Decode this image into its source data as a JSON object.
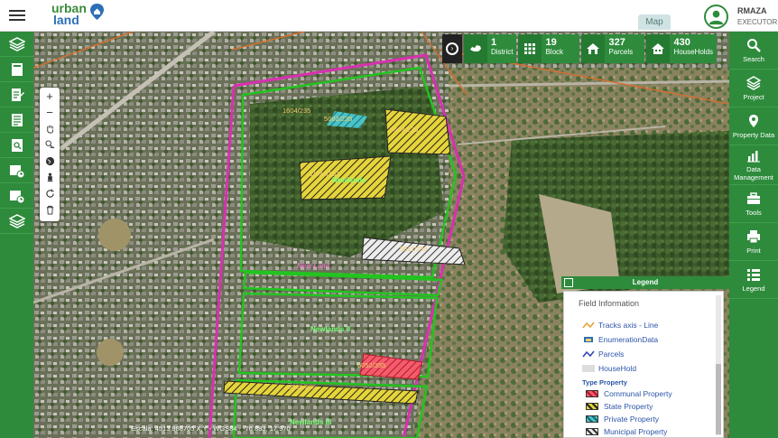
{
  "header": {
    "logo_line1": "urban",
    "logo_line2": "land",
    "map_tab": "Map",
    "user_name": "RMAZA",
    "user_role": "EXECUTOR"
  },
  "stats": [
    {
      "value": "1",
      "label": "District",
      "icon": "map-icon"
    },
    {
      "value": "19",
      "label": "Block",
      "icon": "grid-icon"
    },
    {
      "value": "327",
      "label": "Parcels",
      "icon": "house-icon"
    },
    {
      "value": "430",
      "label": "HouseHolds",
      "icon": "houses-icon"
    }
  ],
  "right_menu": [
    {
      "label": "Search",
      "icon": "search-icon"
    },
    {
      "label": "Project",
      "icon": "layers-icon"
    },
    {
      "label": "Property Data",
      "icon": "pin-icon"
    },
    {
      "label": "Data Management",
      "icon": "bar-chart-icon"
    },
    {
      "label": "Tools",
      "icon": "toolbox-icon"
    },
    {
      "label": "Print",
      "icon": "printer-icon"
    },
    {
      "label": "Legend",
      "icon": "list-icon"
    }
  ],
  "map_labels": {
    "parcel1": "1604/235",
    "parcel2": "5682/235",
    "parcel3": "5643/235",
    "parcel4": "1/333/153",
    "parcel5": "5611/235",
    "parcel6": "6052/355",
    "parcel7": "6585/235",
    "area1": "Newlands",
    "area2": "New Land",
    "area3": "Newlands II",
    "area4": "Newlands III"
  },
  "legend": {
    "header": "Legend",
    "field_info": "Field Information",
    "items": [
      {
        "label": "Tracks axis - Line"
      },
      {
        "label": "EnumerationData"
      },
      {
        "label": "Parcels"
      },
      {
        "label": "HouseHold"
      }
    ],
    "type_title": "Type Property",
    "types": [
      {
        "label": "Communal Property",
        "color": "#f45b6b"
      },
      {
        "label": "State Property",
        "color": "#e5d43a"
      },
      {
        "label": "Private Property",
        "color": "#49c3c8"
      },
      {
        "label": "Municipal Property",
        "color": "#e0e0e0"
      }
    ]
  },
  "scale_text": "Escala: 4513.988705 X,Y - WGS84 - -76.883, 17.970",
  "colors": {
    "brand_green": "#2e8b3c",
    "boundary_magenta": "#d930b0",
    "parcel_green": "#22c41f"
  }
}
